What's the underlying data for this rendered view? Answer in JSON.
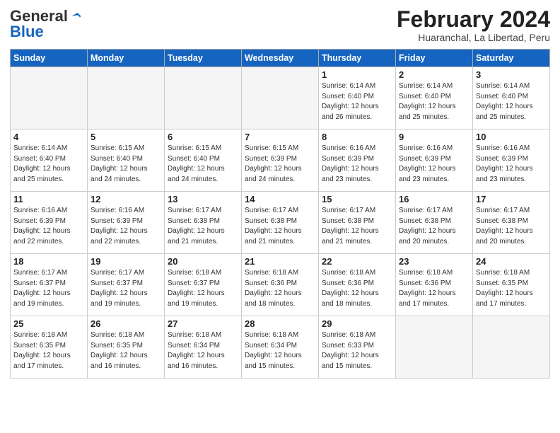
{
  "header": {
    "logo_general": "General",
    "logo_blue": "Blue",
    "month_year": "February 2024",
    "location": "Huaranchal, La Libertad, Peru"
  },
  "days_of_week": [
    "Sunday",
    "Monday",
    "Tuesday",
    "Wednesday",
    "Thursday",
    "Friday",
    "Saturday"
  ],
  "weeks": [
    [
      {
        "day": "",
        "info": ""
      },
      {
        "day": "",
        "info": ""
      },
      {
        "day": "",
        "info": ""
      },
      {
        "day": "",
        "info": ""
      },
      {
        "day": "1",
        "info": "Sunrise: 6:14 AM\nSunset: 6:40 PM\nDaylight: 12 hours and 26 minutes."
      },
      {
        "day": "2",
        "info": "Sunrise: 6:14 AM\nSunset: 6:40 PM\nDaylight: 12 hours and 25 minutes."
      },
      {
        "day": "3",
        "info": "Sunrise: 6:14 AM\nSunset: 6:40 PM\nDaylight: 12 hours and 25 minutes."
      }
    ],
    [
      {
        "day": "4",
        "info": "Sunrise: 6:14 AM\nSunset: 6:40 PM\nDaylight: 12 hours and 25 minutes."
      },
      {
        "day": "5",
        "info": "Sunrise: 6:15 AM\nSunset: 6:40 PM\nDaylight: 12 hours and 24 minutes."
      },
      {
        "day": "6",
        "info": "Sunrise: 6:15 AM\nSunset: 6:40 PM\nDaylight: 12 hours and 24 minutes."
      },
      {
        "day": "7",
        "info": "Sunrise: 6:15 AM\nSunset: 6:39 PM\nDaylight: 12 hours and 24 minutes."
      },
      {
        "day": "8",
        "info": "Sunrise: 6:16 AM\nSunset: 6:39 PM\nDaylight: 12 hours and 23 minutes."
      },
      {
        "day": "9",
        "info": "Sunrise: 6:16 AM\nSunset: 6:39 PM\nDaylight: 12 hours and 23 minutes."
      },
      {
        "day": "10",
        "info": "Sunrise: 6:16 AM\nSunset: 6:39 PM\nDaylight: 12 hours and 23 minutes."
      }
    ],
    [
      {
        "day": "11",
        "info": "Sunrise: 6:16 AM\nSunset: 6:39 PM\nDaylight: 12 hours and 22 minutes."
      },
      {
        "day": "12",
        "info": "Sunrise: 6:16 AM\nSunset: 6:39 PM\nDaylight: 12 hours and 22 minutes."
      },
      {
        "day": "13",
        "info": "Sunrise: 6:17 AM\nSunset: 6:38 PM\nDaylight: 12 hours and 21 minutes."
      },
      {
        "day": "14",
        "info": "Sunrise: 6:17 AM\nSunset: 6:38 PM\nDaylight: 12 hours and 21 minutes."
      },
      {
        "day": "15",
        "info": "Sunrise: 6:17 AM\nSunset: 6:38 PM\nDaylight: 12 hours and 21 minutes."
      },
      {
        "day": "16",
        "info": "Sunrise: 6:17 AM\nSunset: 6:38 PM\nDaylight: 12 hours and 20 minutes."
      },
      {
        "day": "17",
        "info": "Sunrise: 6:17 AM\nSunset: 6:38 PM\nDaylight: 12 hours and 20 minutes."
      }
    ],
    [
      {
        "day": "18",
        "info": "Sunrise: 6:17 AM\nSunset: 6:37 PM\nDaylight: 12 hours and 19 minutes."
      },
      {
        "day": "19",
        "info": "Sunrise: 6:17 AM\nSunset: 6:37 PM\nDaylight: 12 hours and 19 minutes."
      },
      {
        "day": "20",
        "info": "Sunrise: 6:18 AM\nSunset: 6:37 PM\nDaylight: 12 hours and 19 minutes."
      },
      {
        "day": "21",
        "info": "Sunrise: 6:18 AM\nSunset: 6:36 PM\nDaylight: 12 hours and 18 minutes."
      },
      {
        "day": "22",
        "info": "Sunrise: 6:18 AM\nSunset: 6:36 PM\nDaylight: 12 hours and 18 minutes."
      },
      {
        "day": "23",
        "info": "Sunrise: 6:18 AM\nSunset: 6:36 PM\nDaylight: 12 hours and 17 minutes."
      },
      {
        "day": "24",
        "info": "Sunrise: 6:18 AM\nSunset: 6:35 PM\nDaylight: 12 hours and 17 minutes."
      }
    ],
    [
      {
        "day": "25",
        "info": "Sunrise: 6:18 AM\nSunset: 6:35 PM\nDaylight: 12 hours and 17 minutes."
      },
      {
        "day": "26",
        "info": "Sunrise: 6:18 AM\nSunset: 6:35 PM\nDaylight: 12 hours and 16 minutes."
      },
      {
        "day": "27",
        "info": "Sunrise: 6:18 AM\nSunset: 6:34 PM\nDaylight: 12 hours and 16 minutes."
      },
      {
        "day": "28",
        "info": "Sunrise: 6:18 AM\nSunset: 6:34 PM\nDaylight: 12 hours and 15 minutes."
      },
      {
        "day": "29",
        "info": "Sunrise: 6:18 AM\nSunset: 6:33 PM\nDaylight: 12 hours and 15 minutes."
      },
      {
        "day": "",
        "info": ""
      },
      {
        "day": "",
        "info": ""
      }
    ]
  ]
}
